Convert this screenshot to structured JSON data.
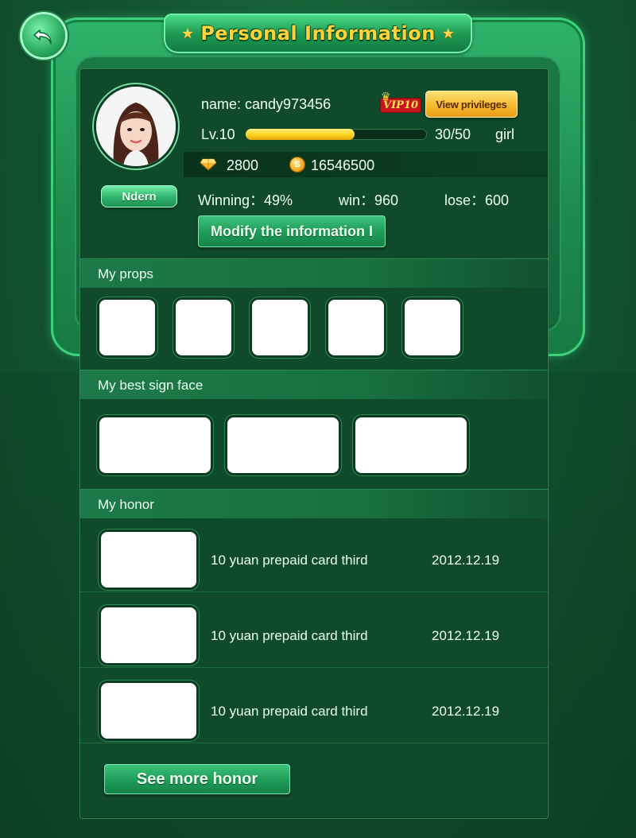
{
  "window": {
    "title": "Personal Information"
  },
  "profile": {
    "name_line": "name: candy973456",
    "vip_label": "VIP10",
    "view_privileges_label": "View privileges",
    "level_label": "Lv.10",
    "level_progress": 0.6,
    "level_count": "30/50",
    "gender": "girl",
    "gems": "2800",
    "coins": "16546500",
    "rank_label": "Ndern",
    "winning": "Winning：49%",
    "wins": "win：960",
    "losses": "lose：600",
    "modify_label": "Modify the information I"
  },
  "props": {
    "title": "My props",
    "slot_count": 5
  },
  "sign_face": {
    "title": "My best sign face",
    "slot_count": 3
  },
  "honor": {
    "title": "My honor",
    "rows": [
      {
        "name": "10 yuan prepaid card third",
        "date": "2012.12.19"
      },
      {
        "name": "10 yuan prepaid card third",
        "date": "2012.12.19"
      },
      {
        "name": "10 yuan prepaid card third",
        "date": "2012.12.19"
      }
    ],
    "more_label": "See more honor"
  },
  "icons": {
    "back": "back-arrow-icon",
    "title_star": "star-icon",
    "gem": "diamond-icon",
    "coin": "coin-icon",
    "crown": "crown-icon"
  },
  "colors": {
    "title_gold": "#ffd23a",
    "panel_bg": "#0f4a2b",
    "accent_green": "#2fb36a",
    "privilege_gold": "#f5b72a"
  }
}
